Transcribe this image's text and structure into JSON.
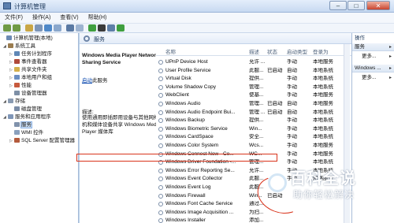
{
  "window": {
    "title": "计算机管理",
    "min_glyph": "–",
    "max_glyph": "□",
    "close_glyph": "✕"
  },
  "menu": [
    "文件(F)",
    "操作(A)",
    "查看(V)",
    "帮助(H)"
  ],
  "tree": [
    {
      "label": "计算机管理(本地)",
      "icon": "computer-icon",
      "expander": ""
    },
    {
      "label": "系统工具",
      "icon": "tools-icon",
      "expander": "◢"
    },
    {
      "label": "任务计划程序",
      "icon": "clock-icon",
      "expander": "▷"
    },
    {
      "label": "事件查看器",
      "icon": "event-icon",
      "expander": "▷"
    },
    {
      "label": "共享文件夹",
      "icon": "folder-icon",
      "expander": "▷"
    },
    {
      "label": "本地用户和组",
      "icon": "users-icon",
      "expander": "▷"
    },
    {
      "label": "性能",
      "icon": "perf-icon",
      "expander": "▷"
    },
    {
      "label": "设备管理器",
      "icon": "device-icon",
      "expander": ""
    },
    {
      "label": "存储",
      "icon": "storage-icon",
      "expander": "◢"
    },
    {
      "label": "磁盘管理",
      "icon": "disk-icon",
      "expander": ""
    },
    {
      "label": "服务和应用程序",
      "icon": "services-icon",
      "expander": "◢"
    },
    {
      "label": "服务",
      "icon": "gear-icon",
      "expander": ""
    },
    {
      "label": "WMI 控件",
      "icon": "wmi-icon",
      "expander": ""
    },
    {
      "label": "SQL Server 配置管理器",
      "icon": "sql-icon",
      "expander": "▷"
    }
  ],
  "center": {
    "header": "服务",
    "description": {
      "service_title": "Windows Media Player Network Sharing Service",
      "link_prefix": "启动",
      "link_rest": "此服务",
      "desc_label": "描述:",
      "desc_text": "使用通用即插即用设备与其他网络播放机和媒体设备共享 Windows Media Player 媒体库"
    },
    "columns": {
      "name": "名称",
      "desc": "描述",
      "status": "状态",
      "startup": "启动类型",
      "logon": "登录为"
    },
    "rows": [
      {
        "name": "UPnP Device Host",
        "desc": "允许 ...",
        "status": "",
        "startup": "手动",
        "logon": "本地服务"
      },
      {
        "name": "User Profile Service",
        "desc": "此服...",
        "status": "已启动",
        "startup": "自动",
        "logon": "本地系统"
      },
      {
        "name": "Virtual Disk",
        "desc": "提供...",
        "status": "",
        "startup": "手动",
        "logon": "本地系统"
      },
      {
        "name": "Volume Shadow Copy",
        "desc": "管理...",
        "status": "",
        "startup": "手动",
        "logon": "本地系统"
      },
      {
        "name": "WebClient",
        "desc": "使基...",
        "status": "",
        "startup": "手动",
        "logon": "本地服务"
      },
      {
        "name": "Windows Audio",
        "desc": "管理...",
        "status": "已启动",
        "startup": "自动",
        "logon": "本地服务"
      },
      {
        "name": "Windows Audio Endpoint Bui...",
        "desc": "管理 ...",
        "status": "已启动",
        "startup": "自动",
        "logon": "本地系统"
      },
      {
        "name": "Windows Backup",
        "desc": "提供...",
        "status": "",
        "startup": "手动",
        "logon": "本地系统"
      },
      {
        "name": "Windows Biometric Service",
        "desc": "Win...",
        "status": "",
        "startup": "手动",
        "logon": "本地系统"
      },
      {
        "name": "Windows CardSpace",
        "desc": "安全...",
        "status": "",
        "startup": "手动",
        "logon": "本地系统"
      },
      {
        "name": "Windows Color System",
        "desc": "Wcs...",
        "status": "",
        "startup": "手动",
        "logon": "本地服务"
      },
      {
        "name": "Windows Connect Now - Co...",
        "desc": "WC...",
        "status": "",
        "startup": "手动",
        "logon": "本地服务"
      },
      {
        "name": "Windows Driver Foundation -...",
        "desc": "管理...",
        "status": "",
        "startup": "手动",
        "logon": "本地系统"
      },
      {
        "name": "Windows Error Reporting Se...",
        "desc": "允许...",
        "status": "",
        "startup": "手动",
        "logon": "本地系统"
      },
      {
        "name": "Windows Event Collector",
        "desc": "此服...",
        "status": "",
        "startup": "手动",
        "logon": "网络服务"
      },
      {
        "name": "Windows Event Log",
        "desc": "此服...",
        "status": "",
        "startup": "",
        "logon": ""
      },
      {
        "name": "Windows Firewall",
        "desc": "Win...",
        "status": "已启动",
        "startup": "",
        "logon": ""
      },
      {
        "name": "Windows Font Cache Service",
        "desc": "通过...",
        "status": "",
        "startup": "",
        "logon": ""
      },
      {
        "name": "Windows Image Acquisition ...",
        "desc": "为扫...",
        "status": "",
        "startup": "",
        "logon": ""
      },
      {
        "name": "Windows Installer",
        "desc": "添加...",
        "status": "",
        "startup": "",
        "logon": ""
      }
    ]
  },
  "actions": {
    "header": "操作",
    "sections": [
      {
        "title": "服务",
        "item": "更多..."
      },
      {
        "title": "Windows ...",
        "item": "更多..."
      }
    ],
    "arrow": "▸"
  },
  "watermark": {
    "title": "百科全说",
    "subtitle": "助你轻松解决"
  },
  "colors": {
    "highlight": "#d9341c",
    "selection": "#cde0f7",
    "link": "#0645ad"
  }
}
